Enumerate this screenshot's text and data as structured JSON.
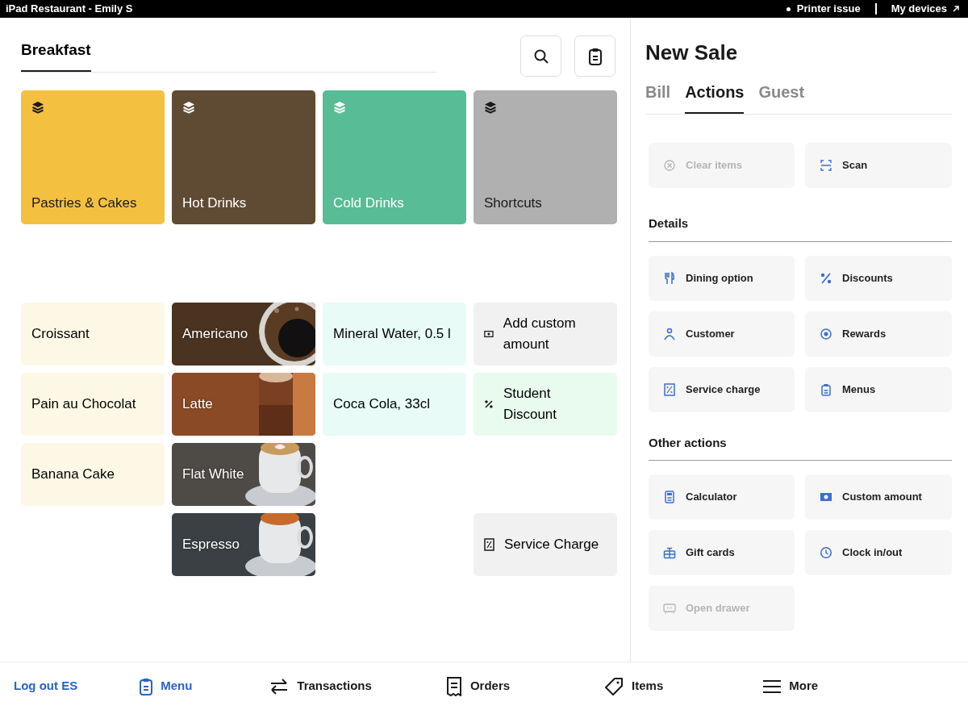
{
  "top_bar": {
    "title": "iPad Restaurant - Emily S",
    "printer_status": "Printer issue",
    "devices_link": "My devices"
  },
  "menu_tabs": [
    {
      "label": "Breakfast",
      "selected": true
    }
  ],
  "categories": [
    {
      "label": "Pastries & Cakes",
      "color": "#f4c040"
    },
    {
      "label": "Hot Drinks",
      "color": "#5f4a33"
    },
    {
      "label": "Cold Drinks",
      "color": "#58bc96"
    },
    {
      "label": "Shortcuts",
      "color": "#b0b0b0"
    }
  ],
  "item_rows": [
    [
      {
        "kind": "plain",
        "label": "Croissant",
        "color": "#fdf8e6"
      },
      {
        "label": "Americano"
      },
      {
        "kind": "plain",
        "label": "Mineral Water, 0.5 l",
        "color": "#e8fbf6"
      },
      {
        "kind": "action",
        "label": "Add custom amount",
        "color": "#f1f1f1"
      }
    ],
    [
      {
        "kind": "plain",
        "label": "Pain au Chocolat",
        "color": "#fdf8e6"
      },
      {
        "label": "Latte"
      },
      {
        "kind": "plain",
        "label": "Coca Cola, 33cl",
        "color": "#e8fbf6"
      },
      {
        "kind": "action",
        "label": "Student Discount",
        "color": "#e9fbef"
      }
    ],
    [
      {
        "kind": "plain",
        "label": "Banana Cake",
        "color": "#fdf8e6"
      },
      {
        "label": "Flat White"
      },
      null,
      null
    ],
    [
      null,
      {
        "label": "Espresso"
      },
      null,
      {
        "kind": "action",
        "label": "Service Charge",
        "color": "#f1f1f1"
      }
    ]
  ],
  "sale": {
    "title": "New Sale",
    "tabs": [
      {
        "label": "Bill",
        "selected": false
      },
      {
        "label": "Actions",
        "selected": true
      },
      {
        "label": "Guest",
        "selected": false
      }
    ],
    "quick_actions": [
      {
        "label": "Clear items",
        "disabled": true
      },
      {
        "label": "Scan",
        "disabled": false
      }
    ],
    "sections": [
      {
        "title": "Details",
        "actions": [
          {
            "label": "Dining option",
            "disabled": false
          },
          {
            "label": "Discounts",
            "disabled": false
          },
          {
            "label": "Customer",
            "disabled": false
          },
          {
            "label": "Rewards",
            "disabled": false
          },
          {
            "label": "Service charge",
            "disabled": false
          },
          {
            "label": "Menus",
            "disabled": false
          }
        ]
      },
      {
        "title": "Other actions",
        "actions": [
          {
            "label": "Calculator",
            "disabled": false
          },
          {
            "label": "Custom amount",
            "disabled": false
          },
          {
            "label": "Gift cards",
            "disabled": false
          },
          {
            "label": "Clock in/out",
            "disabled": false
          },
          {
            "label": "Open drawer",
            "disabled": true
          }
        ]
      }
    ]
  },
  "bottom_nav": {
    "logout": "Log out ES",
    "items": [
      {
        "label": "Menu",
        "selected": true
      },
      {
        "label": "Transactions",
        "selected": false
      },
      {
        "label": "Orders",
        "selected": false
      },
      {
        "label": "Items",
        "selected": false
      },
      {
        "label": "More",
        "selected": false
      }
    ]
  }
}
